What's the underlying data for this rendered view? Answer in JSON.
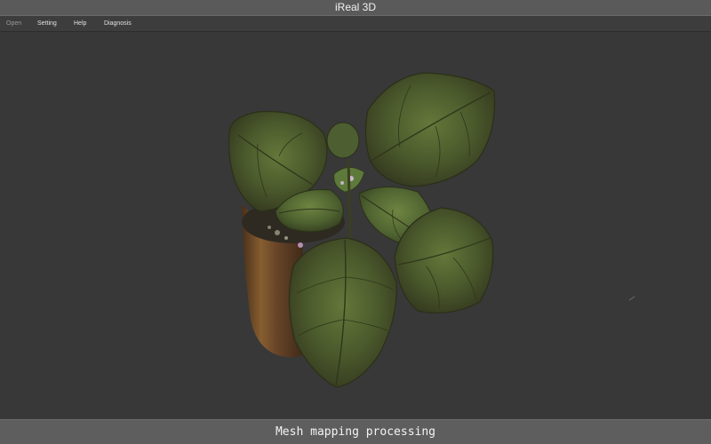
{
  "window": {
    "title": "iReal 3D"
  },
  "menu": {
    "items": [
      {
        "label": "Open",
        "enabled": false
      },
      {
        "label": "Setting",
        "enabled": true
      },
      {
        "label": "Help",
        "enabled": true
      },
      {
        "label": "Diagnosis",
        "enabled": true
      }
    ]
  },
  "viewport": {
    "background_color": "#383838",
    "content": "3d-plant-model"
  },
  "status": {
    "text": "Mesh mapping processing"
  },
  "colors": {
    "titlebar": "#5a5a5a",
    "statusbar": "#5e5e5e",
    "leaf": "#4b5a2c",
    "pot": "#6a4527"
  }
}
